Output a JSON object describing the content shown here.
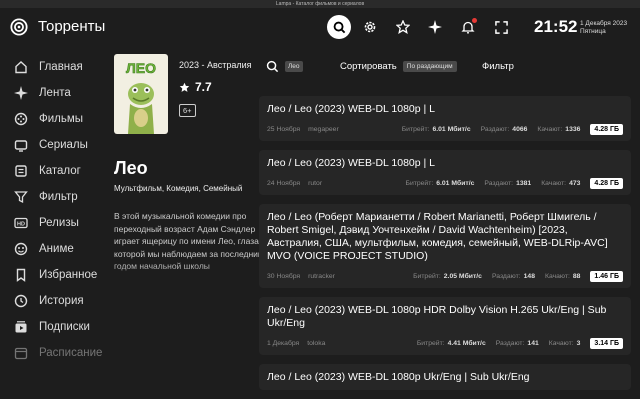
{
  "window": {
    "title": "Lampa - Каталог фильмов и сериалов"
  },
  "header": {
    "app_name": "Торренты",
    "time": "21:52",
    "date_line1": "1 Декабря 2023",
    "date_line2": "Пятница"
  },
  "sidebar": {
    "items": [
      {
        "label": "Главная",
        "icon": "home-icon"
      },
      {
        "label": "Лента",
        "icon": "sparkle-icon"
      },
      {
        "label": "Фильмы",
        "icon": "film-icon"
      },
      {
        "label": "Сериалы",
        "icon": "tv-icon"
      },
      {
        "label": "Каталог",
        "icon": "catalog-icon"
      },
      {
        "label": "Фильтр",
        "icon": "filter-icon"
      },
      {
        "label": "Релизы",
        "icon": "hd-icon"
      },
      {
        "label": "Аниме",
        "icon": "anime-icon"
      },
      {
        "label": "Избранное",
        "icon": "bookmark-icon"
      },
      {
        "label": "История",
        "icon": "history-icon"
      },
      {
        "label": "Подписки",
        "icon": "subscriptions-icon"
      },
      {
        "label": "Расписание",
        "icon": "calendar-icon"
      }
    ]
  },
  "movie": {
    "poster_text": "ЛЕО",
    "year_country": "2023 - Австралия",
    "rating": "7.7",
    "age": "6+",
    "title": "Лео",
    "genres": "Мультфильм, Комедия, Семейный",
    "description": "В этой музыкальной комедии про переходный возраст Адам Сэндлер играет ящерицу по имени Лео, глазами которой мы наблюдаем за последним годом начальной школы"
  },
  "filters": {
    "search_tag": "Лео",
    "sort_label": "Сортировать",
    "sort_value": "По раздающим",
    "filter_label": "Фильтр"
  },
  "torrent_labels": {
    "bitrate": "Битрейт:",
    "seeders": "Раздают:",
    "leechers": "Качают:"
  },
  "torrents": [
    {
      "title": "Лео / Leo (2023) WEB-DL 1080p | L",
      "date": "25 Ноября",
      "tracker": "megapeer",
      "bitrate": "6.01 Мбит/с",
      "seeders": "4066",
      "leechers": "1336",
      "size": "4.28 ГБ"
    },
    {
      "title": "Лео / Leo (2023) WEB-DL 1080p | L",
      "date": "24 Ноября",
      "tracker": "rutor",
      "bitrate": "6.01 Мбит/с",
      "seeders": "1381",
      "leechers": "473",
      "size": "4.28 ГБ"
    },
    {
      "title": "Лео / Leo (Роберт Марианетти / Robert Marianetti, Роберт Шмигель / Robert Smigel, Дэвид Уочтенхейм / David Wachtenheim) [2023, Австралия, США, мультфильм, комедия, семейный, WEB-DLRip-AVC] MVO (VOICE PROJECT STUDIO)",
      "date": "30 Ноября",
      "tracker": "rutracker",
      "bitrate": "2.05 Мбит/с",
      "seeders": "148",
      "leechers": "88",
      "size": "1.46 ГБ"
    },
    {
      "title": "Лео / Leo (2023) WEB-DL 1080p HDR Dolby Vision H.265 Ukr/Eng | Sub Ukr/Eng",
      "date": "1 Декабря",
      "tracker": "toloka",
      "bitrate": "4.41 Мбит/с",
      "seeders": "141",
      "leechers": "3",
      "size": "3.14 ГБ"
    },
    {
      "title": "Лео / Leo (2023) WEB-DL 1080p Ukr/Eng | Sub Ukr/Eng",
      "date": "",
      "tracker": "",
      "bitrate": "",
      "seeders": "",
      "leechers": "",
      "size": ""
    }
  ]
}
